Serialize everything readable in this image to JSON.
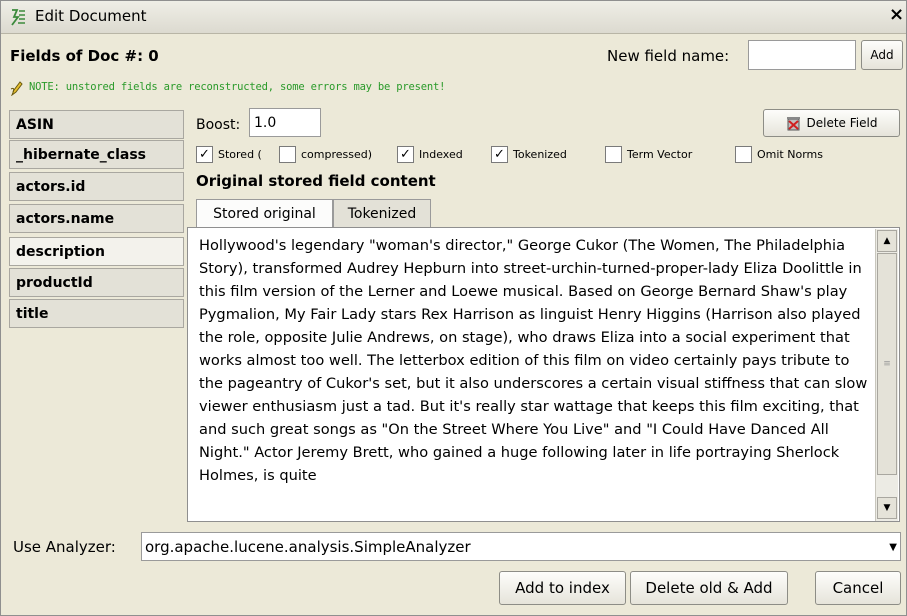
{
  "window": {
    "title": "Edit Document",
    "close_glyph": "×"
  },
  "header": {
    "fields_of_doc": "Fields of Doc #: 0",
    "new_field_label": "New field name:",
    "new_field_value": "",
    "add_label": "Add"
  },
  "note": {
    "text": "NOTE: unstored fields are reconstructed, some errors may be present!",
    "icon": "pencil-note-icon",
    "color": "#2a9a2a"
  },
  "fields": [
    {
      "label": "ASIN"
    },
    {
      "label": "_hibernate_class"
    },
    {
      "label": "actors.id"
    },
    {
      "label": "actors.name"
    },
    {
      "label": "description"
    },
    {
      "label": "productId"
    },
    {
      "label": "title"
    }
  ],
  "selected_field": "description",
  "editor": {
    "boost_label": "Boost:",
    "boost_value": "1.0",
    "delete_field_label": "Delete Field",
    "checkboxes": [
      {
        "label": "Stored (",
        "checked": true
      },
      {
        "label": "compressed)",
        "checked": false
      },
      {
        "label": "Indexed",
        "checked": true
      },
      {
        "label": "Tokenized",
        "checked": true
      },
      {
        "label": "Term Vector",
        "checked": false
      },
      {
        "label": "Omit Norms",
        "checked": false
      }
    ],
    "heading": "Original stored field content",
    "tabs": [
      "Stored original",
      "Tokenized"
    ],
    "active_tab": "Stored original",
    "content": "Hollywood's legendary \"woman's director,\" George Cukor (The Women, The Philadelphia Story), transformed Audrey Hepburn into street-urchin-turned-proper-lady Eliza Doolittle in this film version of the Lerner and Loewe musical. Based on George Bernard Shaw's play Pygmalion, My Fair Lady stars Rex Harrison as linguist Henry Higgins (Harrison also played the role, opposite Julie Andrews, on stage), who draws Eliza into a social experiment that works almost too well. The letterbox edition of this film on video certainly pays tribute to the pageantry of Cukor's set, but it also underscores a certain visual stiffness that can slow viewer enthusiasm just a tad. But it's really star wattage that keeps this film exciting, that and such great songs as \"On the Street Where You Live\" and \"I Could Have Danced All Night.\" Actor Jeremy Brett, who gained a huge following later in life portraying Sherlock Holmes, is quite"
  },
  "analyzer": {
    "label": "Use Analyzer:",
    "value": "org.apache.lucene.analysis.SimpleAnalyzer"
  },
  "buttons": {
    "add_to_index": "Add to index",
    "delete_old_add": "Delete old & Add",
    "cancel": "Cancel"
  }
}
